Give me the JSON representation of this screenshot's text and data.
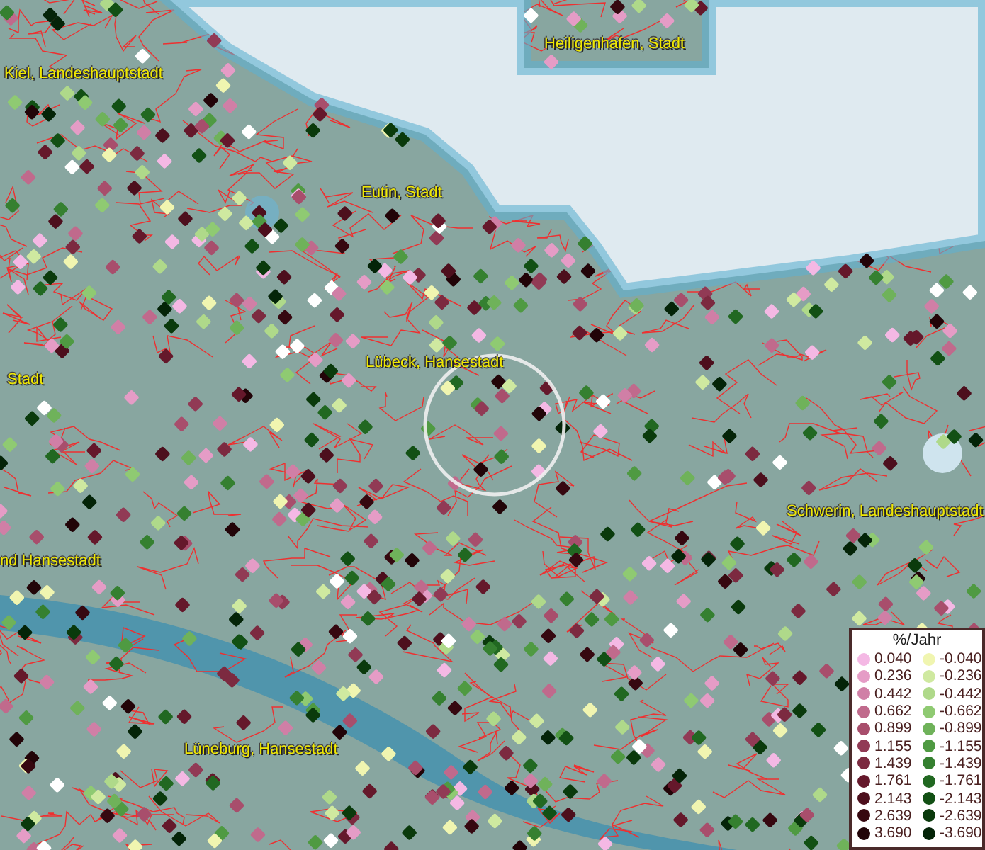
{
  "map_labels": [
    {
      "text": "Heiligenhafen, Stadt"
    },
    {
      "text": "Kiel, Landeshauptstadt"
    },
    {
      "text": "Eutin, Stadt"
    },
    {
      "text": "Lübeck, Hansestadt"
    },
    {
      "text": "Stadt"
    },
    {
      "text": "Schwerin, Landeshauptstadt"
    },
    {
      "text": "nd Hansestadt"
    },
    {
      "text": "Lüneburg, Hansestadt"
    }
  ],
  "legend": {
    "title": "%/Jahr",
    "entries": [
      {
        "label": "0.040",
        "color": "#f4b8e4"
      },
      {
        "label": "-0.040",
        "color": "#f0f5b0"
      },
      {
        "label": "0.236",
        "color": "#e59cc6"
      },
      {
        "label": "-0.236",
        "color": "#cfe9a0"
      },
      {
        "label": "0.442",
        "color": "#d07fa6"
      },
      {
        "label": "-0.442",
        "color": "#afd98a"
      },
      {
        "label": "0.662",
        "color": "#c06a8c"
      },
      {
        "label": "-0.662",
        "color": "#8fca72"
      },
      {
        "label": "0.899",
        "color": "#a84e6c"
      },
      {
        "label": "-0.899",
        "color": "#6fb25a"
      },
      {
        "label": "1.155",
        "color": "#913a55"
      },
      {
        "label": "-1.155",
        "color": "#4f9a42"
      },
      {
        "label": "1.439",
        "color": "#7c2a40"
      },
      {
        "label": "-1.439",
        "color": "#358030"
      },
      {
        "label": "1.761",
        "color": "#65182b"
      },
      {
        "label": "-1.761",
        "color": "#216821"
      },
      {
        "label": "2.143",
        "color": "#4d0f1d"
      },
      {
        "label": "-2.143",
        "color": "#125014"
      },
      {
        "label": "2.639",
        "color": "#360810"
      },
      {
        "label": "-2.639",
        "color": "#0a3a0c"
      },
      {
        "label": "3.690",
        "color": "#220408"
      },
      {
        "label": "-3.690",
        "color": "#042408"
      }
    ]
  }
}
